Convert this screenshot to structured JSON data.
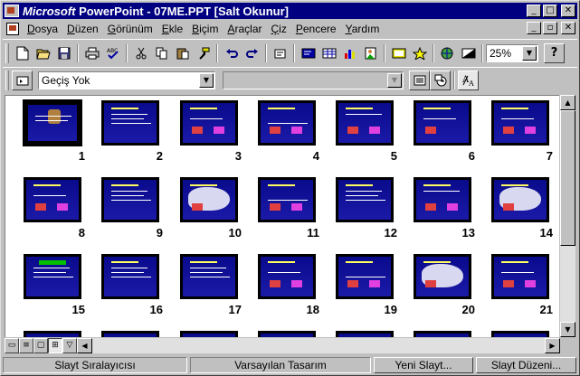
{
  "window": {
    "title_brand": "Microsoft",
    "title_rest": " PowerPoint - 07ME.PPT [Salt Okunur]",
    "title_controls": [
      "_",
      "□",
      "✕"
    ]
  },
  "menu": {
    "items": [
      {
        "u": "D",
        "rest": "osya"
      },
      {
        "u": "D",
        "rest": "üzen"
      },
      {
        "u": "G",
        "rest": "örünüm"
      },
      {
        "u": "E",
        "rest": "kle"
      },
      {
        "u": "B",
        "rest": "içim"
      },
      {
        "u": "A",
        "rest": "raçlar"
      },
      {
        "u": "Ç",
        "rest": "iz"
      },
      {
        "u": "P",
        "rest": "encere"
      },
      {
        "u": "Y",
        "rest": "ardım"
      }
    ],
    "mdi_controls": [
      "_",
      "▫",
      "✕"
    ]
  },
  "toolbar": {
    "zoom_value": "25%",
    "help_icon": "?"
  },
  "toolbar2": {
    "transition_value": "Geçiş Yok",
    "build_value": ""
  },
  "slides": [
    {
      "num": "1",
      "style": "title"
    },
    {
      "num": "2",
      "style": "text"
    },
    {
      "num": "3",
      "style": "diagram"
    },
    {
      "num": "4",
      "style": "ovals"
    },
    {
      "num": "5",
      "style": "network"
    },
    {
      "num": "6",
      "style": "icons"
    },
    {
      "num": "7",
      "style": "flow"
    },
    {
      "num": "8",
      "style": "flow"
    },
    {
      "num": "9",
      "style": "text"
    },
    {
      "num": "10",
      "style": "map"
    },
    {
      "num": "11",
      "style": "boxes"
    },
    {
      "num": "12",
      "style": "text"
    },
    {
      "num": "13",
      "style": "network"
    },
    {
      "num": "14",
      "style": "map"
    },
    {
      "num": "15",
      "style": "green"
    },
    {
      "num": "16",
      "style": "text"
    },
    {
      "num": "17",
      "style": "text"
    },
    {
      "num": "18",
      "style": "diagram"
    },
    {
      "num": "19",
      "style": "boxes"
    },
    {
      "num": "20",
      "style": "map"
    },
    {
      "num": "21",
      "style": "flow"
    }
  ],
  "statusbar": {
    "view_name": "Slayt Sıralayıcısı",
    "design": "Varsayılan Tasarım",
    "new_slide": "Yeni Slayt...",
    "layout": "Slayt Düzeni..."
  }
}
